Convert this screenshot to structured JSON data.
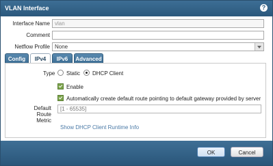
{
  "window": {
    "title": "VLAN Interface"
  },
  "form": {
    "interface_name_label": "Interface Name",
    "interface_name_value": "vlan",
    "comment_label": "Comment",
    "comment_value": "",
    "netflow_label": "Netflow Profile",
    "netflow_value": "None"
  },
  "tabs": [
    {
      "label": "Config",
      "active": false
    },
    {
      "label": "IPv4",
      "active": true
    },
    {
      "label": "IPv6",
      "active": false
    },
    {
      "label": "Advanced",
      "active": false
    }
  ],
  "ipv4": {
    "type_label": "Type",
    "options": [
      {
        "label": "Static",
        "selected": false
      },
      {
        "label": "DHCP Client",
        "selected": true
      }
    ],
    "enable_label": "Enable",
    "enable_checked": true,
    "auto_route_label": "Automatically create default route pointing to default gateway provided by server",
    "auto_route_checked": true,
    "metric_label": "Default Route Metric",
    "metric_placeholder": "[1 - 65535]",
    "runtime_link": "Show DHCP Client Runtime Info"
  },
  "footer": {
    "ok_label": "OK",
    "cancel_label": "Cancel"
  },
  "icons": {
    "help": "help-icon"
  }
}
